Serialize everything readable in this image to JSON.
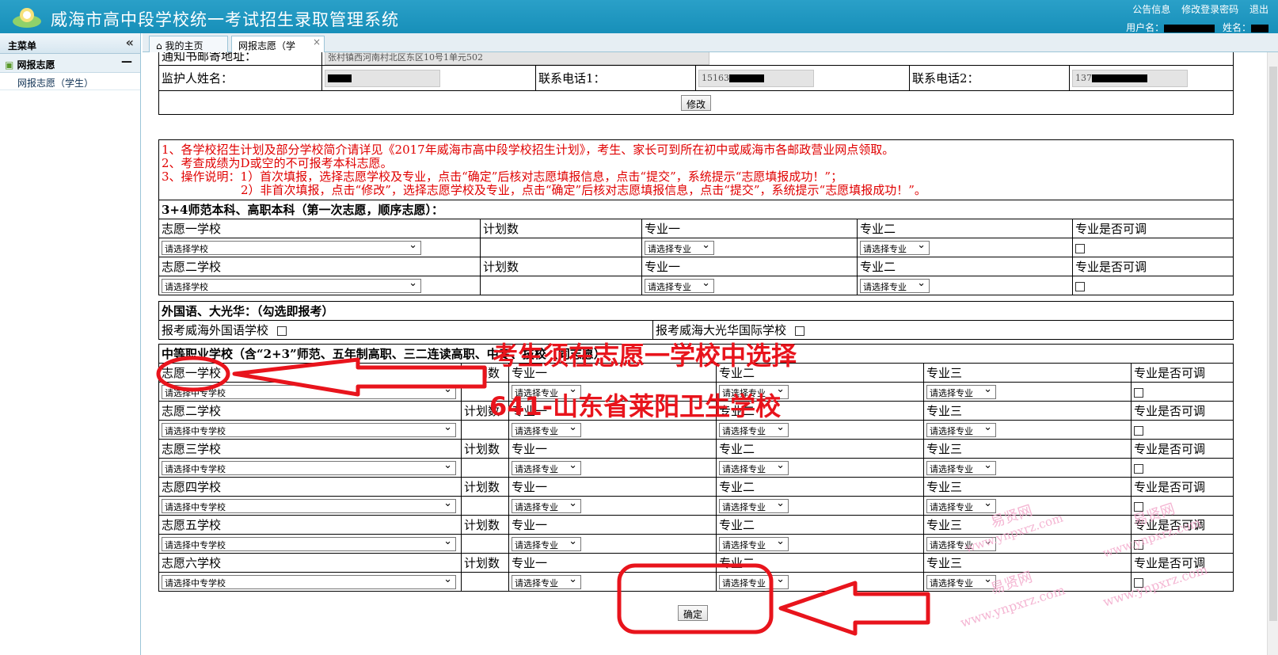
{
  "app": {
    "title": "威海市高中段学校统一考试招生录取管理系统"
  },
  "toplinks": [
    "公告信息",
    "修改登录密码",
    "退出"
  ],
  "user": {
    "username_label": "用户名：",
    "name_label": "姓名："
  },
  "sidebar": {
    "header": "主菜单",
    "collapse": "«",
    "group": "网报志愿",
    "group_toggle": "—",
    "item": "网报志愿（学生）"
  },
  "tabs": [
    {
      "label": "我的主页"
    },
    {
      "label": "网报志愿（学"
    }
  ],
  "tab_close": "×",
  "contact": {
    "address_label": "通知书邮寄地址：",
    "address_value": "张村镇西河南村北区东区10号1单元502",
    "guardian_label": "监护人姓名：",
    "phone1_label": "联系电话1：",
    "phone1_value": "15163",
    "phone2_label": "联系电话2：",
    "phone2_value": "137",
    "modify_button": "修改"
  },
  "notes": {
    "l1": "1、各学校招生计划及部分学校简介请详见《2017年威海市高中段学校招生计划》，考生、家长可到所在初中或威海市各邮政营业网点领取。",
    "l2": "2、考查成绩为D或空的不可报考本科志愿。",
    "l3": "3、操作说明：1）首次填报，选择志愿学校及专业，点击“确定”后核对志愿填报信息，点击“提交”，系统提示“志愿填报成功！”；",
    "l4": "2）非首次填报，点击“修改”，选择志愿学校及专业，点击“确定”后核对志愿填报信息，点击“提交”，系统提示“志愿填报成功！”。"
  },
  "section1": {
    "title": "3+4师范本科、高职本科（第一次志愿，顺序志愿）：",
    "plan_label": "计划数",
    "major1": "专业一",
    "major2": "专业二",
    "adjust": "专业是否可调",
    "school_placeholder": "请选择学校",
    "major_placeholder": "请选择专业",
    "rows": [
      "志愿一学校",
      "志愿二学校"
    ]
  },
  "section2": {
    "title": "外国语、大光华：（勾选即报考）",
    "foreign": "报考威海外国语学校",
    "guanghua": "报考威海大光华国际学校"
  },
  "section3": {
    "title": "中等职业学校（含“2+3”师范、五年制高职、三二连读高职、中专、技校（同志愿）",
    "plan_label": "计划数",
    "major1": "专业一",
    "major2": "专业二",
    "major3": "专业三",
    "adjust": "专业是否可调",
    "school_placeholder": "请选择中专学校",
    "major_placeholder": "请选择专业",
    "rows": [
      "志愿一学校",
      "志愿二学校",
      "志愿三学校",
      "志愿四学校",
      "志愿五学校",
      "志愿六学校"
    ]
  },
  "confirm_button": "确定",
  "annotation": {
    "line1": "考生须在志愿一学校中选择",
    "line2": "641-山东省莱阳卫生学校"
  },
  "watermarks": [
    "易贤网",
    "www.ynpxrz.com"
  ],
  "colors": {
    "header": "#1e97c1",
    "annotation": "#e8141c",
    "notes": "#e00000"
  }
}
